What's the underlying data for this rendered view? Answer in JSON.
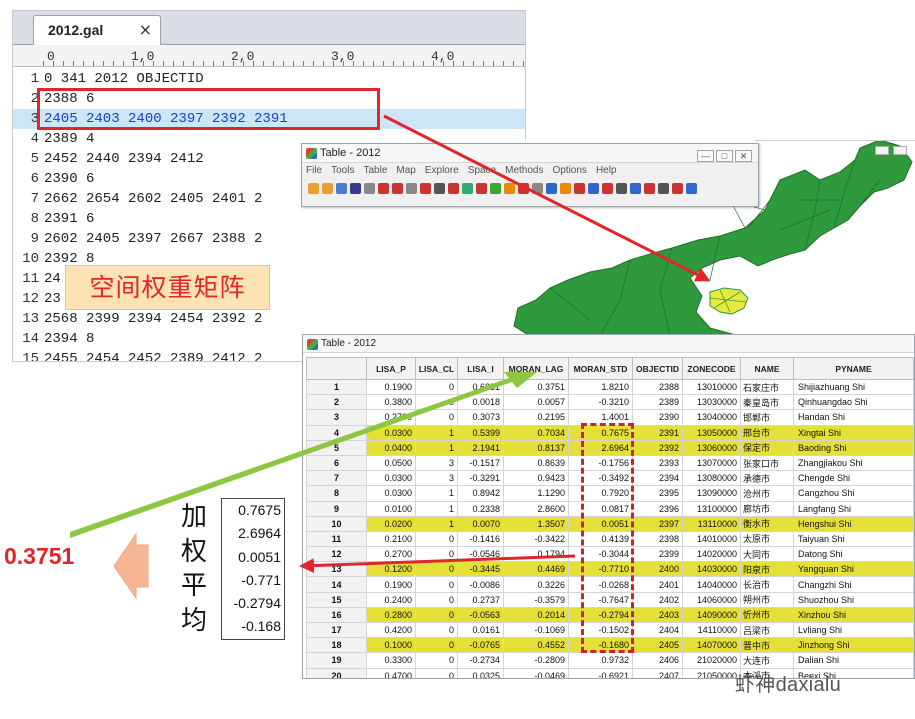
{
  "editor": {
    "tab_label": "2012.gal",
    "close_glyph": "×",
    "ruler_ticks": [
      "0",
      "1,0",
      "2,0",
      "3,0",
      "4,0"
    ],
    "lines": [
      {
        "n": "1",
        "text": "0 341 2012 OBJECTID"
      },
      {
        "n": "2",
        "text": "2388 6"
      },
      {
        "n": "3",
        "text": "2405 2403 2400 2397 2392 2391"
      },
      {
        "n": "4",
        "text": "2389 4"
      },
      {
        "n": "5",
        "text": "2452 2440 2394 2412"
      },
      {
        "n": "6",
        "text": "2390 6"
      },
      {
        "n": "7",
        "text": "2662 2654 2602 2405 2401 2"
      },
      {
        "n": "8",
        "text": "2391 6"
      },
      {
        "n": "9",
        "text": "2602 2405 2397 2667 2388 2"
      },
      {
        "n": "10",
        "text": "2392 8"
      },
      {
        "n": "11",
        "text": "24                         05 2"
      },
      {
        "n": "12",
        "text": "23                           2"
      },
      {
        "n": "13",
        "text": "2568 2399 2394 2454 2392 2"
      },
      {
        "n": "14",
        "text": "2394 8"
      },
      {
        "n": "15",
        "text": "2455 2454 2452 2389 2412 2"
      }
    ],
    "highlighted_line": 3
  },
  "label_weight": "空间权重矩阵",
  "toolwin": {
    "title": "Table - 2012",
    "menus": [
      "File",
      "Tools",
      "Table",
      "Map",
      "Explore",
      "Space",
      "Methods",
      "Options",
      "Help"
    ],
    "tool_colors": [
      "#e8a030",
      "#e8a030",
      "#4a7bd0",
      "#3a3a8a",
      "#888",
      "#c33",
      "#c33",
      "#888",
      "#c33",
      "#555",
      "#c33",
      "#3a7",
      "#c33",
      "#3a3",
      "#e80",
      "#c33",
      "#888",
      "#36c",
      "#e80",
      "#c33",
      "#36c",
      "#c33",
      "#555",
      "#36c",
      "#c33",
      "#555",
      "#c33",
      "#36c"
    ]
  },
  "tablewin": {
    "title": "Table - 2012",
    "columns": [
      "",
      "LISA_P",
      "LISA_CL",
      "LISA_I",
      "MORAN_LAG",
      "MORAN_STD",
      "OBJECTID",
      "ZONECODE",
      "NAME",
      "PYNAME"
    ],
    "rows": [
      {
        "id": "1",
        "lisa_p": "0.1900",
        "lisa_cl": "0",
        "lisa_i": "0.6831",
        "moran_lag": "0.3751",
        "moran_std": "1.8210",
        "objectid": "2388",
        "zonecode": "13010000",
        "name": "石家庄市",
        "pyname": "Shijiazhuang Shi",
        "sel": false
      },
      {
        "id": "2",
        "lisa_p": "0.3800",
        "lisa_cl": "0",
        "lisa_i": "0.0018",
        "moran_lag": "0.0057",
        "moran_std": "-0.3210",
        "objectid": "2389",
        "zonecode": "13030000",
        "name": "秦皇岛市",
        "pyname": "Qinhuangdao Shi",
        "sel": false
      },
      {
        "id": "3",
        "lisa_p": "0.2700",
        "lisa_cl": "0",
        "lisa_i": "0.3073",
        "moran_lag": "0.2195",
        "moran_std": "1.4001",
        "objectid": "2390",
        "zonecode": "13040000",
        "name": "邯郸市",
        "pyname": "Handan Shi",
        "sel": false
      },
      {
        "id": "4",
        "lisa_p": "0.0300",
        "lisa_cl": "1",
        "lisa_i": "0.5399",
        "moran_lag": "0.7034",
        "moran_std": "0.7675",
        "objectid": "2391",
        "zonecode": "13050000",
        "name": "邢台市",
        "pyname": "Xingtai Shi",
        "sel": true
      },
      {
        "id": "5",
        "lisa_p": "0.0400",
        "lisa_cl": "1",
        "lisa_i": "2.1941",
        "moran_lag": "0.8137",
        "moran_std": "2.6964",
        "objectid": "2392",
        "zonecode": "13060000",
        "name": "保定市",
        "pyname": "Baoding Shi",
        "sel": true
      },
      {
        "id": "6",
        "lisa_p": "0.0500",
        "lisa_cl": "3",
        "lisa_i": "-0.1517",
        "moran_lag": "0.8639",
        "moran_std": "-0.1756",
        "objectid": "2393",
        "zonecode": "13070000",
        "name": "张家口市",
        "pyname": "Zhangjiakou Shi",
        "sel": false
      },
      {
        "id": "7",
        "lisa_p": "0.0300",
        "lisa_cl": "3",
        "lisa_i": "-0.3291",
        "moran_lag": "0.9423",
        "moran_std": "-0.3492",
        "objectid": "2394",
        "zonecode": "13080000",
        "name": "承德市",
        "pyname": "Chengde Shi",
        "sel": false
      },
      {
        "id": "8",
        "lisa_p": "0.0300",
        "lisa_cl": "1",
        "lisa_i": "0.8942",
        "moran_lag": "1.1290",
        "moran_std": "0.7920",
        "objectid": "2395",
        "zonecode": "13090000",
        "name": "沧州市",
        "pyname": "Cangzhou Shi",
        "sel": false
      },
      {
        "id": "9",
        "lisa_p": "0.0100",
        "lisa_cl": "1",
        "lisa_i": "0.2338",
        "moran_lag": "2.8600",
        "moran_std": "0.0817",
        "objectid": "2396",
        "zonecode": "13100000",
        "name": "廊坊市",
        "pyname": "Langfang Shi",
        "sel": false
      },
      {
        "id": "10",
        "lisa_p": "0.0200",
        "lisa_cl": "1",
        "lisa_i": "0.0070",
        "moran_lag": "1.3507",
        "moran_std": "0.0051",
        "objectid": "2397",
        "zonecode": "13110000",
        "name": "衡水市",
        "pyname": "Hengshui Shi",
        "sel": true
      },
      {
        "id": "11",
        "lisa_p": "0.2100",
        "lisa_cl": "0",
        "lisa_i": "-0.1416",
        "moran_lag": "-0.3422",
        "moran_std": "0.4139",
        "objectid": "2398",
        "zonecode": "14010000",
        "name": "太原市",
        "pyname": "Taiyuan Shi",
        "sel": false
      },
      {
        "id": "12",
        "lisa_p": "0.2700",
        "lisa_cl": "0",
        "lisa_i": "-0.0546",
        "moran_lag": "0.1794",
        "moran_std": "-0.3044",
        "objectid": "2399",
        "zonecode": "14020000",
        "name": "大同市",
        "pyname": "Datong Shi",
        "sel": false
      },
      {
        "id": "13",
        "lisa_p": "0.1200",
        "lisa_cl": "0",
        "lisa_i": "-0.3445",
        "moran_lag": "0.4469",
        "moran_std": "-0.7710",
        "objectid": "2400",
        "zonecode": "14030000",
        "name": "阳泉市",
        "pyname": "Yangquan Shi",
        "sel": true
      },
      {
        "id": "14",
        "lisa_p": "0.1900",
        "lisa_cl": "0",
        "lisa_i": "-0.0086",
        "moran_lag": "0.3226",
        "moran_std": "-0.0268",
        "objectid": "2401",
        "zonecode": "14040000",
        "name": "长治市",
        "pyname": "Changzhi Shi",
        "sel": false
      },
      {
        "id": "15",
        "lisa_p": "0.2400",
        "lisa_cl": "0",
        "lisa_i": "0.2737",
        "moran_lag": "-0.3579",
        "moran_std": "-0.7647",
        "objectid": "2402",
        "zonecode": "14060000",
        "name": "朔州市",
        "pyname": "Shuozhou Shi",
        "sel": false
      },
      {
        "id": "16",
        "lisa_p": "0.2800",
        "lisa_cl": "0",
        "lisa_i": "-0.0563",
        "moran_lag": "0.2014",
        "moran_std": "-0.2794",
        "objectid": "2403",
        "zonecode": "14090000",
        "name": "忻州市",
        "pyname": "Xinzhou Shi",
        "sel": true
      },
      {
        "id": "17",
        "lisa_p": "0.4200",
        "lisa_cl": "0",
        "lisa_i": "0.0161",
        "moran_lag": "-0.1069",
        "moran_std": "-0.1502",
        "objectid": "2404",
        "zonecode": "14110000",
        "name": "吕梁市",
        "pyname": "Lvliang Shi",
        "sel": false
      },
      {
        "id": "18",
        "lisa_p": "0.1000",
        "lisa_cl": "0",
        "lisa_i": "-0.0765",
        "moran_lag": "0.4552",
        "moran_std": "-0.1680",
        "objectid": "2405",
        "zonecode": "14070000",
        "name": "晋中市",
        "pyname": "Jinzhong Shi",
        "sel": true
      },
      {
        "id": "19",
        "lisa_p": "0.3300",
        "lisa_cl": "0",
        "lisa_i": "-0.2734",
        "moran_lag": "-0.2809",
        "moran_std": "0.9732",
        "objectid": "2406",
        "zonecode": "21020000",
        "name": "大连市",
        "pyname": "Dalian Shi",
        "sel": false
      },
      {
        "id": "20",
        "lisa_p": "0.4700",
        "lisa_cl": "0",
        "lisa_i": "0.0325",
        "moran_lag": "-0.0469",
        "moran_std": "-0.6921",
        "objectid": "2407",
        "zonecode": "21050000",
        "name": "本溪市",
        "pyname": "Benxi Shi",
        "sel": false
      }
    ]
  },
  "weight_values": [
    "0.7675",
    "2.6964",
    "0.0051",
    "-0.771",
    "-0.2794",
    "-0.168"
  ],
  "label_avg": [
    "加",
    "权",
    "平",
    "均"
  ],
  "result": "0.3751",
  "watermark": "虾神daxialu",
  "colors": {
    "map_green": "#2e9a3d",
    "selection_yellow": "#e4e038",
    "arrow_red": "#e0262b",
    "arrow_green": "#8dc63f",
    "highlight_blue": "#cde6f7"
  }
}
